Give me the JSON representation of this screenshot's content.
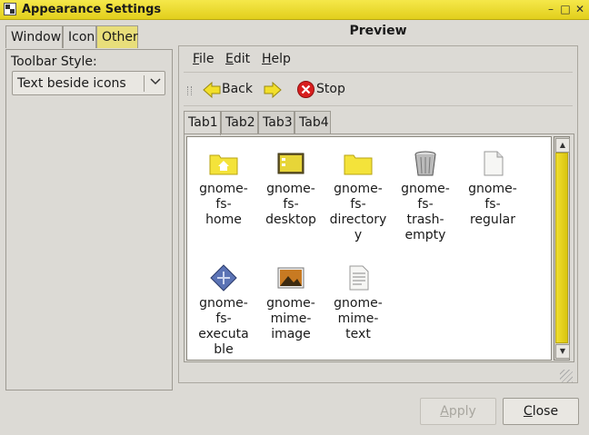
{
  "window": {
    "title": "Appearance Settings",
    "controls": {
      "minimize": "–",
      "maximize": "□",
      "close": "✕"
    }
  },
  "left_tabs": [
    "Window",
    "Icon",
    "Other"
  ],
  "left_active_tab": "Other",
  "toolbar_style": {
    "label": "Toolbar Style:",
    "selected": "Text beside icons"
  },
  "preview": {
    "title": "Preview",
    "menu": [
      {
        "label": "File",
        "mnemonic": "F",
        "rest": "ile"
      },
      {
        "label": "Edit",
        "mnemonic": "E",
        "rest": "dit"
      },
      {
        "label": "Help",
        "mnemonic": "H",
        "rest": "elp"
      }
    ],
    "toolbar": {
      "back_label": "Back",
      "stop_label": "Stop"
    },
    "tabs": [
      "Tab1",
      "Tab2",
      "Tab3",
      "Tab4"
    ],
    "active_tab": "Tab1",
    "icons": [
      {
        "label": "gnome-fs-home",
        "lines": [
          "gnome-",
          "fs-",
          "home"
        ],
        "icon": "home-folder-icon"
      },
      {
        "label": "gnome-fs-desktop",
        "lines": [
          "gnome-",
          "fs-",
          "desktop"
        ],
        "icon": "desktop-icon"
      },
      {
        "label": "gnome-fs-directory",
        "lines": [
          "gnome-",
          "fs-",
          "directory",
          "y"
        ],
        "icon": "folder-icon"
      },
      {
        "label": "gnome-fs-trash-empty",
        "lines": [
          "gnome-",
          "fs-",
          "trash-",
          "empty"
        ],
        "icon": "trash-icon"
      },
      {
        "label": "gnome-fs-regular",
        "lines": [
          "gnome-",
          "fs-",
          "regular"
        ],
        "icon": "regular-file-icon"
      },
      {
        "label": "gnome-fs-executable",
        "lines": [
          "gnome-",
          "fs-",
          "executa",
          "ble"
        ],
        "icon": "executable-icon"
      },
      {
        "label": "gnome-mime-image",
        "lines": [
          "gnome-",
          "mime-",
          "image"
        ],
        "icon": "image-file-icon"
      },
      {
        "label": "gnome-mime-text",
        "lines": [
          "gnome-",
          "mime-",
          "text"
        ],
        "icon": "text-file-icon"
      }
    ]
  },
  "buttons": {
    "apply": {
      "label": "Apply",
      "mnemonic": "A",
      "rest": "pply",
      "enabled": false
    },
    "close": {
      "label": "Close",
      "mnemonic": "C",
      "rest": "lose",
      "enabled": true
    }
  },
  "colors": {
    "accent": "#e8d627",
    "window_bg": "#dcdad5",
    "stop_red": "#d81e1e"
  }
}
